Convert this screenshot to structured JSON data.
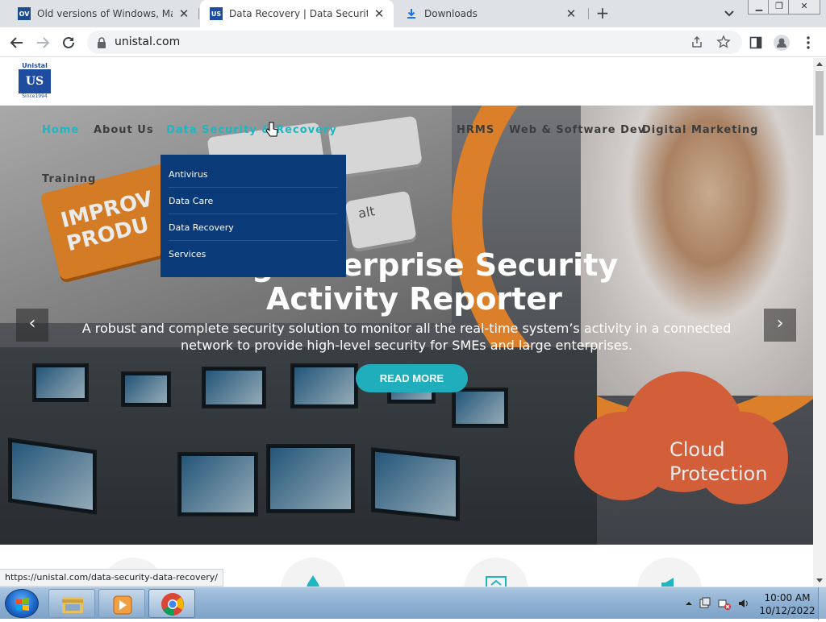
{
  "browser": {
    "tabs": [
      {
        "title": "Old versions of Windows, Mac and",
        "favicon_text": "OV",
        "favicon_color": "#1d4b8f",
        "active": false
      },
      {
        "title": "Data Recovery | Data Security | Pl",
        "favicon_text": "US",
        "favicon_color": "#1e4da0",
        "active": true
      },
      {
        "title": "Downloads",
        "favicon_icon": "download-icon",
        "active": false
      }
    ],
    "new_tab_symbol": "+",
    "address": "unistal.com",
    "status_url": "https://unistal.com/data-security-data-recovery/"
  },
  "site": {
    "logo": {
      "brand": "Unistal",
      "mark": "US",
      "since": "Since1994"
    },
    "nav": [
      {
        "label": "Home"
      },
      {
        "label": "About Us"
      },
      {
        "label": "Data Security & Recovery"
      },
      {
        "label": "HRMS"
      },
      {
        "label": "Web & Software Dev"
      },
      {
        "label": "Digital Marketing"
      },
      {
        "label": "Training"
      }
    ],
    "dropdown": [
      "Antivirus",
      "Data Care",
      "Data Recovery",
      "Services"
    ],
    "hero": {
      "title_line1": "g   Enterprise Security",
      "title_line2": "Activity Reporter",
      "subtitle": "A robust and complete security solution to monitor all the real-time system’s activity in a connected network to provide high-level security for SMEs and large enterprises.",
      "cta": "READ MORE",
      "key_text": "IMPROV PRODU",
      "key_small": "alt",
      "cloud_text": "Cloud Protection"
    },
    "arrows": {
      "prev": "‹",
      "next": "›"
    }
  },
  "taskbar": {
    "time": "10:00 AM",
    "date": "10/12/2022",
    "apps": [
      "explorer-icon",
      "media-player-icon",
      "chrome-icon"
    ]
  },
  "colors": {
    "accent": "#1fb6c3",
    "dropdown_bg": "#0b3a78",
    "brand_blue": "#1e4da0"
  }
}
